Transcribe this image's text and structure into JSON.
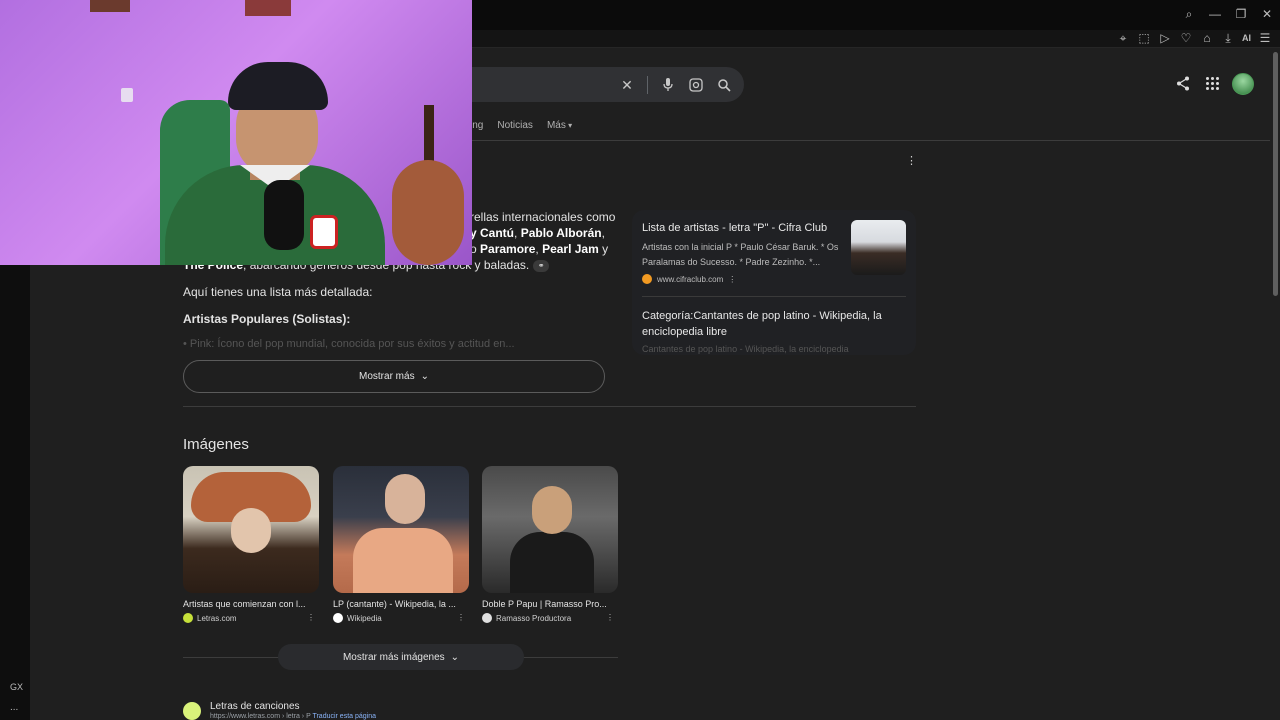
{
  "browser": {
    "ai_label": "AI",
    "sidebar_gx": "GX",
    "sidebar_more": "..."
  },
  "tabs": [
    "ing",
    "Noticias",
    "Más"
  ],
  "ai_answer": {
    "line1": "rellas internacionales como",
    "line2_a": "y Cantú",
    "line2_b": ", ",
    "line2_c": "Pablo Alborán",
    "line2_d": ",",
    "line3_a": "o ",
    "line3_b": "Paramore",
    "line3_c": ", ",
    "line3_d": "Pearl Jam",
    "line3_e": " y",
    "line4_a": "The Police",
    "line4_b": ", abarcando géneros desde pop hasta rock y baladas.",
    "intro": "Aquí tienes una lista más detallada:",
    "section": "Artistas Populares (Solistas):",
    "faded": "• Pink: Ícono del pop mundial, conocida por sus éxitos y actitud en...",
    "show_more": "Mostrar más"
  },
  "side_card": {
    "title": "Lista de artistas - letra \"P\" - Cifra Club",
    "snippet": "Artistas con la inicial P * Paulo César Baruk. * Os Paralamas do Sucesso. * Padre Zezinho. *...",
    "source": "www.cifraclub.com",
    "title2": "Categoría:Cantantes de pop latino - Wikipedia, la enciclopedia libre",
    "fade": "Cantantes de pop latino - Wikipedia, la enciclopedia"
  },
  "images": {
    "heading": "Imágenes",
    "items": [
      {
        "caption": "Artistas que comienzan con l...",
        "source": "Letras.com",
        "color": "#c6e03a"
      },
      {
        "caption": "LP (cantante) - Wikipedia, la ...",
        "source": "Wikipedia",
        "color": "#ffffff"
      },
      {
        "caption": "Doble P Papu | Ramasso Pro...",
        "source": "Ramasso Productora",
        "color": "#e0e0e0"
      }
    ],
    "more": "Mostrar más imágenes"
  },
  "result": {
    "title": "Letras de canciones",
    "url": "https://www.letras.com › letra › P",
    "translate": "Traducir esta página"
  }
}
